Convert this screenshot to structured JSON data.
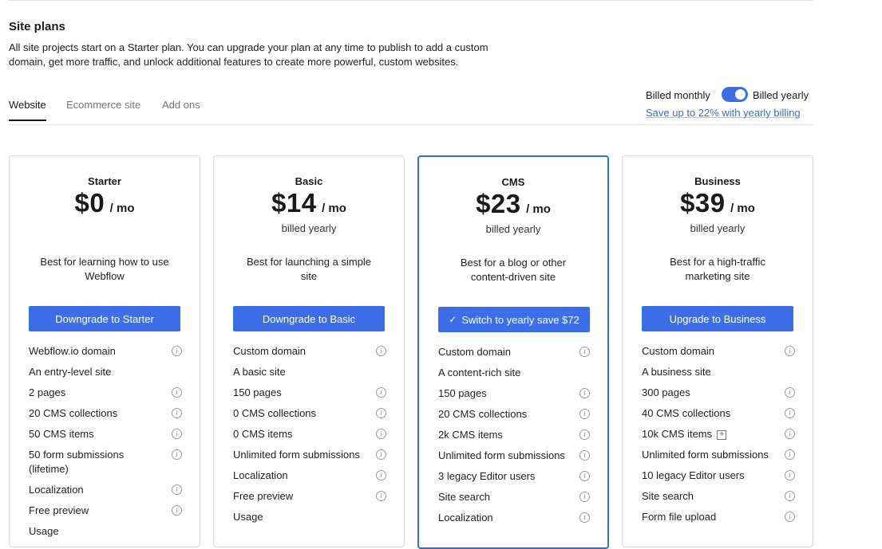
{
  "header": {
    "title": "Site plans",
    "description_line1": "All site projects start on a Starter plan. You can upgrade your plan at any time to publish to add a custom",
    "description_line2": "domain, get more traffic, and unlock additional features to create more powerful, custom websites."
  },
  "tabs": [
    {
      "label": "Website",
      "active": true
    },
    {
      "label": "Ecommerce site",
      "active": false
    },
    {
      "label": "Add ons",
      "active": false
    }
  ],
  "billing": {
    "monthly_label": "Billed monthly",
    "yearly_label": "Billed yearly",
    "yearly_selected": true,
    "save_link": "Save up to 22% with yearly billing"
  },
  "plans": [
    {
      "name": "Starter",
      "price": "$0",
      "per": "/ mo",
      "billed": "",
      "tagline_line1": "Best for learning how to use",
      "tagline_line2": "Webflow",
      "cta": "Downgrade to Starter",
      "features": [
        "Webflow.io domain",
        "An entry-level site",
        "2 pages",
        "20 CMS collections",
        "50 CMS items",
        "50 form submissions",
        "(lifetime)",
        "Localization",
        "Free preview",
        "Usage"
      ]
    },
    {
      "name": "Basic",
      "price": "$14",
      "per": "/ mo",
      "billed": "billed yearly",
      "tagline_line1": "Best for launching a simple",
      "tagline_line2": "site",
      "cta": "Downgrade to Basic",
      "features": [
        "Custom domain",
        "A basic site",
        "150 pages",
        "0 CMS collections",
        "0 CMS items",
        "Unlimited form submissions",
        "Localization",
        "Free preview",
        "Usage"
      ]
    },
    {
      "name": "CMS",
      "price": "$23",
      "per": "/ mo",
      "billed": "billed yearly",
      "tagline_line1": "Best for a blog or other",
      "tagline_line2": "content-driven site",
      "cta": "Switch to yearly save $72",
      "features": [
        "Custom domain",
        "A content-rich site",
        "150 pages",
        "20 CMS collections",
        "2k CMS items",
        "Unlimited form submissions",
        "3 legacy Editor users",
        "Site search",
        "Localization"
      ]
    },
    {
      "name": "Business",
      "price": "$39",
      "per": "/ mo",
      "billed": "billed yearly",
      "tagline_line1": "Best for a high-traffic",
      "tagline_line2": "marketing site",
      "cta": "Upgrade to Business",
      "features": [
        "Custom domain",
        "A business site",
        "300 pages",
        "40 CMS collections",
        "10k CMS items",
        "Unlimited form submissions",
        "10 legacy Editor users",
        "Site search",
        "Form file upload"
      ]
    }
  ],
  "icons": {
    "info": "i",
    "check": "✓",
    "plus": "+"
  }
}
